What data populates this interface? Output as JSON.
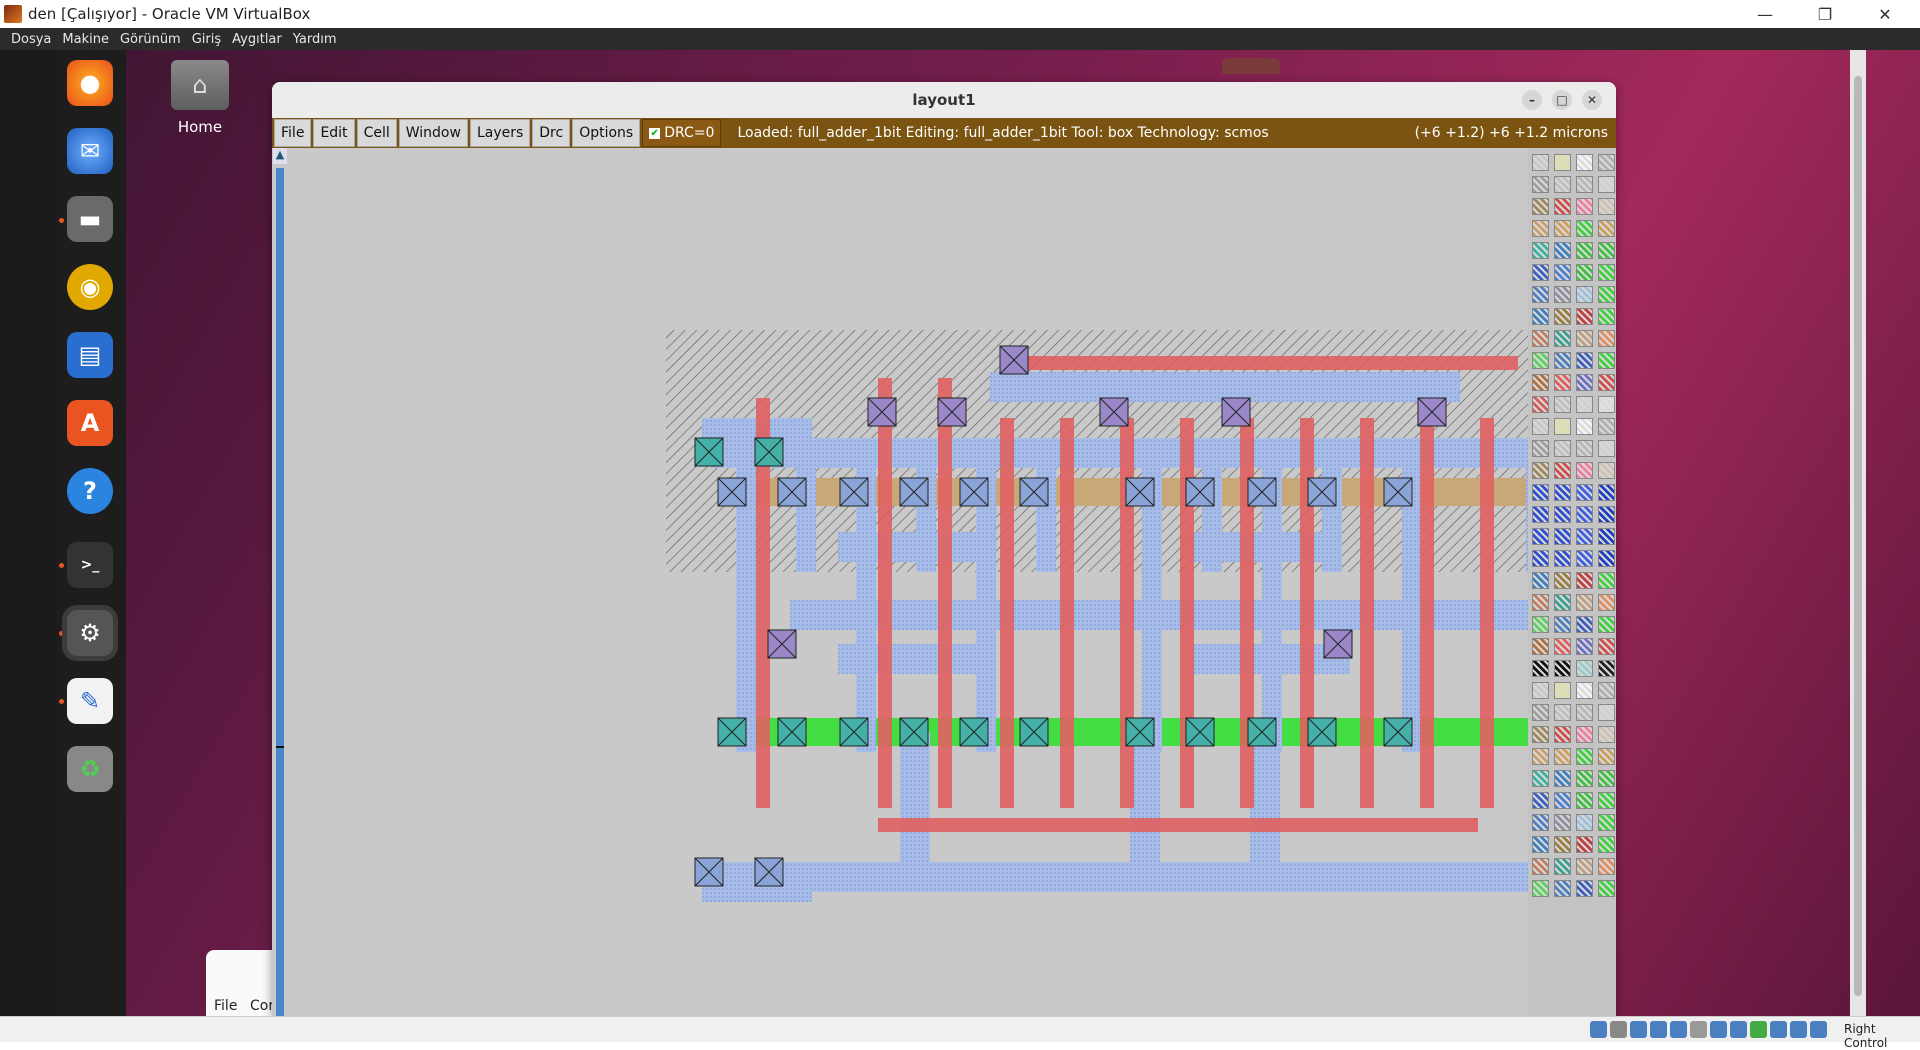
{
  "vbox": {
    "title": "den [Çalışıyor] - Oracle VM VirtualBox",
    "menu": [
      "Dosya",
      "Makine",
      "Görünüm",
      "Giriş",
      "Aygıtlar",
      "Yardım"
    ],
    "host_key": "Right Control"
  },
  "desktop": {
    "home_label": "Home",
    "bg_window_file": "File",
    "bg_window_cor": "Cor"
  },
  "layout_window": {
    "title": "layout1",
    "menu": [
      "File",
      "Edit",
      "Cell",
      "Window",
      "Layers",
      "Drc",
      "Options"
    ],
    "drc_label": "DRC=0",
    "status": "Loaded: full_adder_1bit Editing: full_adder_1bit Tool: box  Technology: scmos",
    "coords": "(+6 +1.2) +6 +1.2 microns"
  },
  "dock_icons": [
    "firefox-icon",
    "thunderbird-icon",
    "files-icon",
    "rhythmbox-icon",
    "libreoffice-writer-icon",
    "app-center-icon",
    "help-icon",
    "terminal-icon",
    "settings-icon",
    "text-editor-icon",
    "trash-icon"
  ],
  "colors": {
    "poly": "#e06060",
    "metal1": "#9fb6e6",
    "pdiff": "#c8a878",
    "ndiff": "#44dd44",
    "contact_m": "#9a88c8",
    "contact_d": "#44b0a8",
    "vbox_menu_bg": "#2b2b2b",
    "magic_menu_bg": "#7a5410"
  }
}
